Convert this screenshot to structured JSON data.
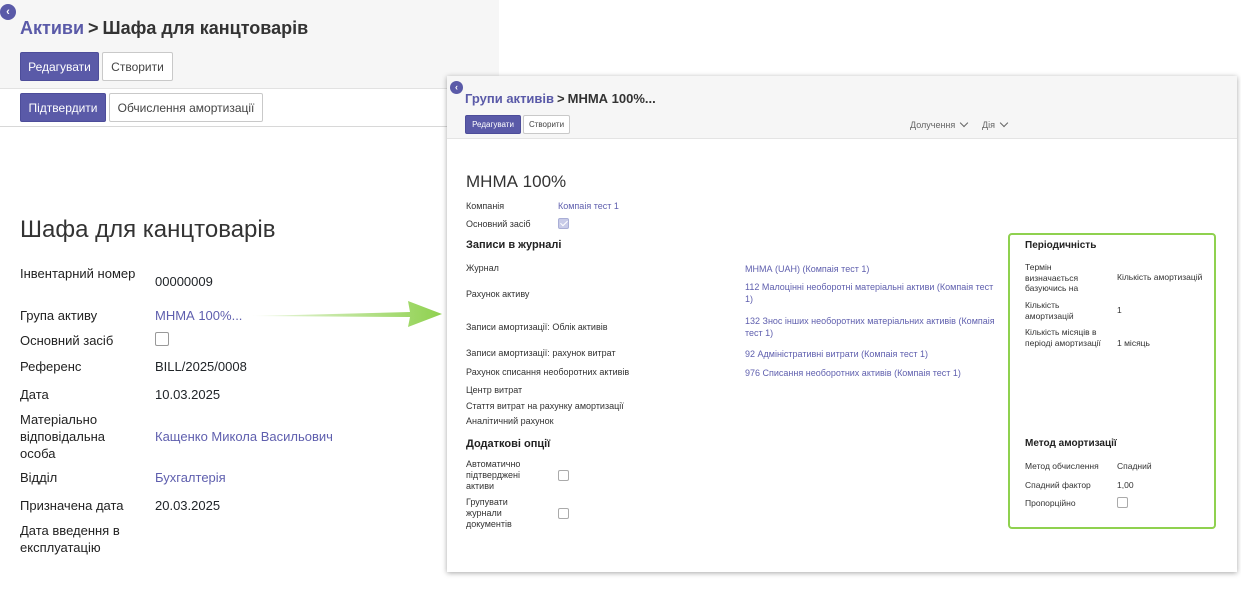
{
  "left_page": {
    "breadcrumb": {
      "root": "Активи",
      "separator": ">",
      "current": "Шафа для канцтоварів"
    },
    "buttons": {
      "edit": "Редагувати",
      "create": "Створити",
      "confirm": "Підтвердити",
      "compute_depreciation": "Обчислення амортизації"
    },
    "title": "Шафа для канцтоварів",
    "fields": [
      {
        "label": "Інвентарний номер",
        "value": "00000009"
      },
      {
        "label": "Група активу",
        "value": "МНМА 100%..."
      },
      {
        "label": "Основний засіб",
        "value": ""
      },
      {
        "label": "Референс",
        "value": "BILL/2025/0008"
      },
      {
        "label": "Дата",
        "value": "10.03.2025"
      },
      {
        "label": "Матеріально відповідальна особа",
        "value": "Кащенко Микола Васильович"
      },
      {
        "label": "Відділ",
        "value": "Бухгалтерія"
      },
      {
        "label": "Призначена дата",
        "value": "20.03.2025"
      },
      {
        "label": "Дата введення в експлуатацію",
        "value": ""
      }
    ],
    "fixed_asset_checked": false
  },
  "popup": {
    "breadcrumb": {
      "root": "Групи активів",
      "separator": ">",
      "current": "МНМА 100%..."
    },
    "buttons": {
      "edit": "Редагувати",
      "create": "Створити"
    },
    "dropdowns": {
      "attachments": "Долучення",
      "action": "Дія"
    },
    "title": "МНМА 100%",
    "company": {
      "label": "Компанія",
      "value": "Компаія тест 1"
    },
    "fixed_asset": {
      "label": "Основний засіб",
      "checked": true
    },
    "journal_section": {
      "title": "Записи в журналі",
      "rows": [
        {
          "label": "Журнал",
          "value": "МНМА (UAH) (Компаія тест 1)"
        },
        {
          "label": "Рахунок активу",
          "value": "112 Малоцінні необоротні матеріальні активи (Компаія тест 1)"
        },
        {
          "label": "Записи амортизації: Облік активів",
          "value": "132 Знос інших необоротних матеріальних активів (Компаія тест 1)"
        },
        {
          "label": "Записи амортизації: рахунок витрат",
          "value": "92 Адміністративні витрати (Компаія тест 1)"
        },
        {
          "label": "Рахунок списання необоротних активів",
          "value": "976 Списання необоротних активів (Компаія тест 1)"
        },
        {
          "label": "Центр витрат",
          "value": ""
        },
        {
          "label": "Стаття витрат на рахунку амортизації",
          "value": ""
        },
        {
          "label": "Аналітичний рахунок",
          "value": ""
        }
      ]
    },
    "extra_options": {
      "title": "Додаткові опції",
      "rows": [
        {
          "label": "Автоматично підтверджені активи",
          "checked": false
        },
        {
          "label": "Групувати журнали документів",
          "checked": false
        }
      ]
    },
    "periodicity": {
      "title": "Періодичність",
      "rows": [
        {
          "label": "Термін визначається базуючись на",
          "value": "Кількість амортизацій"
        },
        {
          "label": "Кількість амортизацій",
          "value": "1"
        },
        {
          "label": "Кількість місяців в періоді амортизації",
          "value": "1 місяць"
        }
      ]
    },
    "depreciation_method": {
      "title": "Метод амортизації",
      "rows": [
        {
          "label": "Метод обчислення",
          "value": "Спадний"
        },
        {
          "label": "Спадний фактор",
          "value": "1,00"
        },
        {
          "label": "Пропорційно",
          "value": ""
        }
      ],
      "prorata_checked": false
    }
  },
  "colors": {
    "primary": "#5a5aa8",
    "link": "#5f5fae",
    "highlight": "#8fd14f"
  }
}
